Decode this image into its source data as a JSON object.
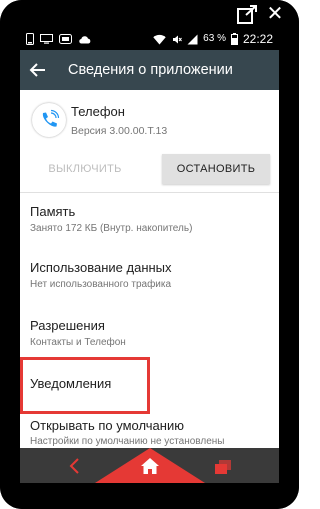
{
  "colors": {
    "app_bar": "#37474f",
    "accent_red": "#e53935",
    "nav_bar": "#3a3a3a",
    "phone_icon_blue": "#2196f3"
  },
  "status_bar": {
    "battery": "63 %",
    "time": "22:22",
    "icons": [
      "phone-icon",
      "screen-icon",
      "cast-icon",
      "cloud-icon",
      "wifi-icon",
      "mute-icon",
      "signal-icon",
      "battery-icon"
    ]
  },
  "app_bar": {
    "title": "Сведения о приложении",
    "back_icon": "arrow-left-icon"
  },
  "app": {
    "name": "Телефон",
    "version": "Версия 3.00.00.T.13",
    "icon": "phone-icon"
  },
  "buttons": {
    "disable": "ВЫКЛЮЧИТЬ",
    "stop": "ОСТАНОВИТЬ"
  },
  "items": [
    {
      "title": "Память",
      "subtitle": "Занято 172 КБ (Внутр. накопитель)"
    },
    {
      "title": "Использование данных",
      "subtitle": "Нет использованного трафика"
    },
    {
      "title": "Разрешения",
      "subtitle": "Контакты и Телефон"
    },
    {
      "title": "Уведомления",
      "subtitle": ""
    },
    {
      "title": "Открывать по умолчанию",
      "subtitle": "Настройки по умолчанию не установлены"
    }
  ],
  "nav_bar": {
    "icons": [
      "back-chevron-icon",
      "home-icon",
      "recent-apps-icon"
    ]
  }
}
